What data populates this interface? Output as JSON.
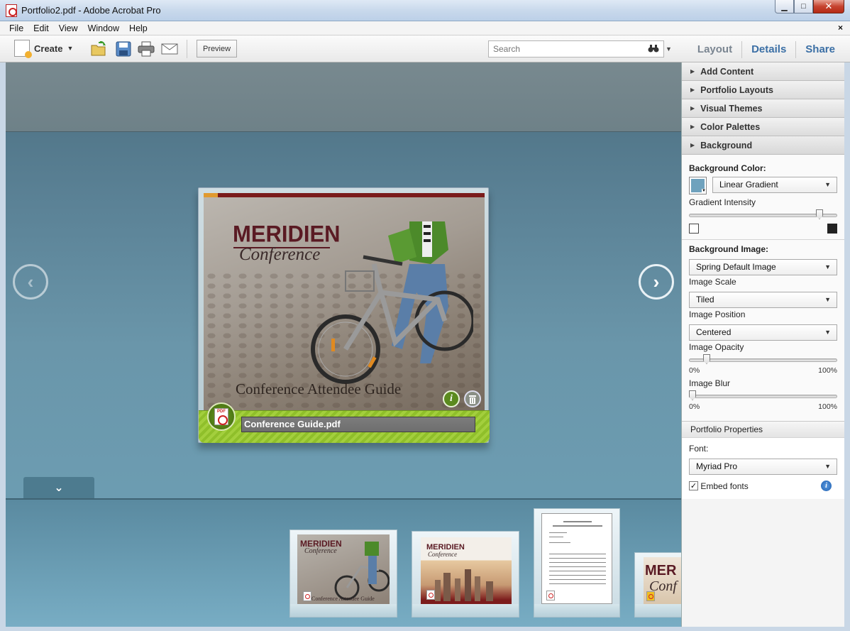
{
  "window": {
    "title": "Portfolio2.pdf - Adobe Acrobat Pro",
    "min_glyph": "▁",
    "max_glyph": "□",
    "close_glyph": "✕"
  },
  "menu": {
    "items": [
      {
        "label": "File"
      },
      {
        "label": "Edit"
      },
      {
        "label": "View"
      },
      {
        "label": "Window"
      },
      {
        "label": "Help"
      }
    ],
    "close_doc": "×"
  },
  "toolbar": {
    "create_label": "Create",
    "preview_label": "Preview",
    "search_placeholder": "Search",
    "tabs": [
      "Layout",
      "Details",
      "Share"
    ]
  },
  "card": {
    "logo_main": "MERIDIEN",
    "logo_sub": "Conference",
    "caption": "Conference Attendee Guide",
    "file_name": "Conference Guide.pdf",
    "info_glyph": "i",
    "pdf_badge": "PDF"
  },
  "thumbnails": {
    "t1_word": "MERIDIEN",
    "t1_sub": "Conference",
    "t1_caption": "Conference Attendee Guide",
    "t2_word": "MERIDIEN",
    "t2_sub": "Conference",
    "t4_word": "MER",
    "t4_sub": "Conf"
  },
  "panel": {
    "accordion": [
      "Add Content",
      "Portfolio Layouts",
      "Visual Themes",
      "Color Palettes",
      "Background"
    ],
    "background_color_label": "Background Color:",
    "gradient_type": "Linear Gradient",
    "gradient_intensity_label": "Gradient Intensity",
    "gradient_intensity_value": 0.9,
    "background_image_label": "Background Image:",
    "background_image_value": "Spring Default Image",
    "image_scale_label": "Image Scale",
    "image_scale_value": "Tiled",
    "image_position_label": "Image Position",
    "image_position_value": "Centered",
    "image_opacity_label": "Image Opacity",
    "image_opacity_value": 0.1,
    "image_blur_label": "Image Blur",
    "image_blur_value": 0,
    "range_min": "0%",
    "range_max": "100%",
    "portfolio_properties_label": "Portfolio Properties",
    "font_label": "Font:",
    "font_value": "Myriad Pro",
    "embed_fonts_label": "Embed fonts",
    "embed_fonts_checked": true,
    "background_swatch_color": "#6fa2bd"
  }
}
